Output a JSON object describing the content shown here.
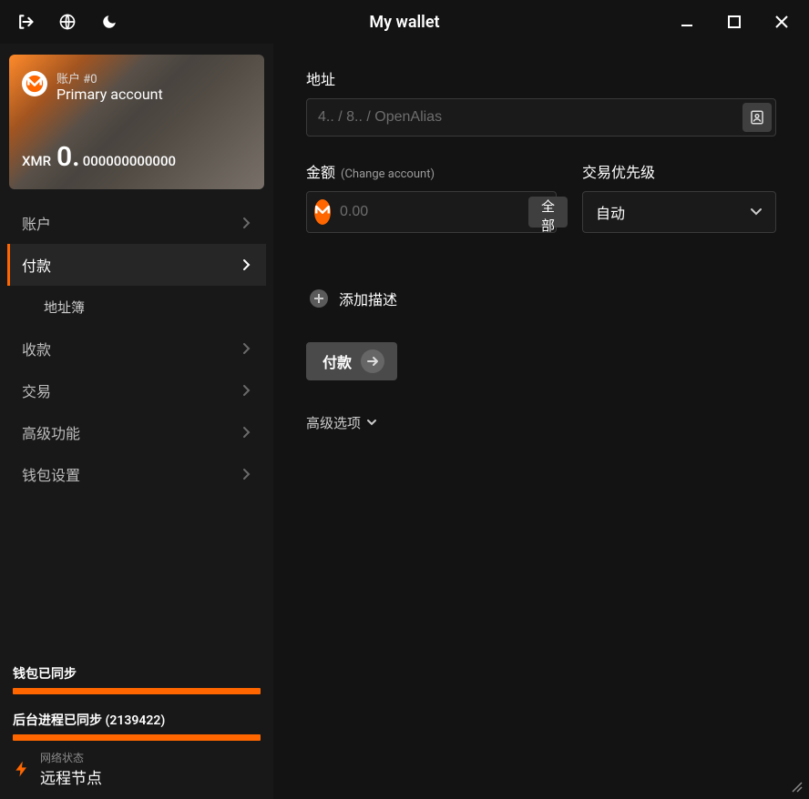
{
  "title": "My wallet",
  "account": {
    "number_label": "账户 #0",
    "name": "Primary account",
    "currency": "XMR",
    "balance_whole": "0.",
    "balance_frac": "000000000000"
  },
  "nav": {
    "accounts": "账户",
    "send": "付款",
    "address_book": "地址簿",
    "receive": "收款",
    "transactions": "交易",
    "advanced": "高级功能",
    "settings": "钱包设置"
  },
  "sync": {
    "wallet_label": "钱包已同步",
    "daemon_label": "后台进程已同步 (2139422)",
    "network_status_label": "网络状态",
    "network_mode": "远程节点"
  },
  "send": {
    "address_label": "地址",
    "address_placeholder": "4.. / 8.. / OpenAlias",
    "amount_label": "金额",
    "change_account": "(Change account)",
    "amount_placeholder": "0.00",
    "all_btn": "全部",
    "priority_label": "交易优先级",
    "priority_value": "自动",
    "add_desc": "添加描述",
    "send_btn": "付款",
    "advanced_options": "高级选项"
  }
}
